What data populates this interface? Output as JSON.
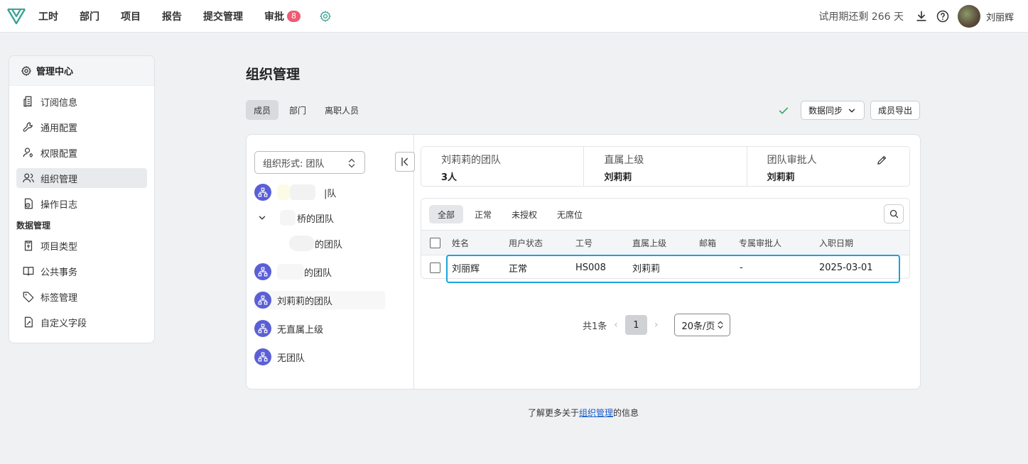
{
  "nav": {
    "items": [
      {
        "label": "工时"
      },
      {
        "label": "部门"
      },
      {
        "label": "项目"
      },
      {
        "label": "报告"
      },
      {
        "label": "提交管理"
      },
      {
        "label": "审批",
        "badge": "8"
      }
    ],
    "trial_text": "试用期还剩 266 天",
    "username": "刘丽辉",
    "accent_color": "#3aa394"
  },
  "sidebar": {
    "header": "管理中心",
    "items": [
      {
        "label": "订阅信息",
        "icon": "receipt-icon"
      },
      {
        "label": "通用配置",
        "icon": "wrench-icon"
      },
      {
        "label": "权限配置",
        "icon": "user-key-icon"
      },
      {
        "label": "组织管理",
        "icon": "users-icon",
        "active": true
      },
      {
        "label": "操作日志",
        "icon": "log-icon"
      }
    ],
    "section": "数据管理",
    "items2": [
      {
        "label": "项目类型",
        "icon": "project-type-icon"
      },
      {
        "label": "公共事务",
        "icon": "book-icon"
      },
      {
        "label": "标签管理",
        "icon": "tag-icon"
      },
      {
        "label": "自定义字段",
        "icon": "custom-field-icon"
      }
    ]
  },
  "main": {
    "title": "组织管理",
    "tabs": [
      {
        "label": "成员",
        "active": true
      },
      {
        "label": "部门"
      },
      {
        "label": "离职人员"
      }
    ],
    "sync_label": "数据同步",
    "export_label": "成员导出",
    "org_select": "组织形式:  团队",
    "tree": [
      {
        "label": "团队",
        "partial": "|队"
      },
      {
        "label": "桥的团队",
        "partial": "桥的团队"
      },
      {
        "label": "的团队",
        "partial": "的团队"
      },
      {
        "label": "的团队",
        "partial": "的团队"
      },
      {
        "label": "刘莉莉的团队"
      },
      {
        "label": "无直属上级"
      },
      {
        "label": "无团队"
      }
    ],
    "summary": [
      {
        "label": "刘莉莉的团队",
        "value": "3人"
      },
      {
        "label": "直属上级",
        "value": "刘莉莉"
      },
      {
        "label": "团队审批人",
        "value": "刘莉莉"
      }
    ],
    "filters": [
      "全部",
      "正常",
      "未授权",
      "无席位"
    ],
    "columns": [
      "姓名",
      "用户状态",
      "工号",
      "直属上级",
      "邮箱",
      "专属审批人",
      "入职日期"
    ],
    "rows": [
      {
        "name": "刘丽辉",
        "status": "正常",
        "id": "HS008",
        "manager": "刘莉莉",
        "email": "",
        "approver": "-",
        "date": "2025-03-01"
      }
    ],
    "pager": {
      "total": "共1条",
      "page": "1",
      "size": "20条/页"
    }
  },
  "footer": {
    "before": "了解更多关于",
    "link": "组织管理",
    "after": "的信息"
  }
}
